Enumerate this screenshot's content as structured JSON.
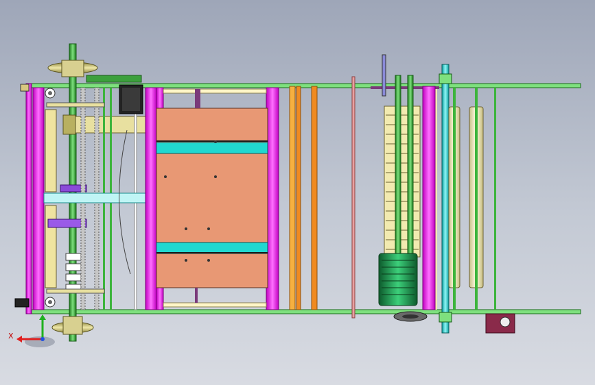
{
  "viewport": {
    "background_top": "#9ea6b8",
    "background_bottom": "#d8dbe2"
  },
  "triad": {
    "x_label": "X",
    "x_color": "#e02020",
    "y_color": "#20b020",
    "z_color": "#2050e0"
  },
  "colors": {
    "frame_green": "#3cb43c",
    "rail_magenta": "#ff00ff",
    "panel_salmon": "#e89874",
    "bar_cyan": "#21d8d0",
    "roller_cream": "#f2eab0",
    "motor_green": "#1f8a4a",
    "gear_olive": "#b8b060",
    "accent_purple": "#8a4ad8",
    "orange_rod": "#f08a20"
  }
}
